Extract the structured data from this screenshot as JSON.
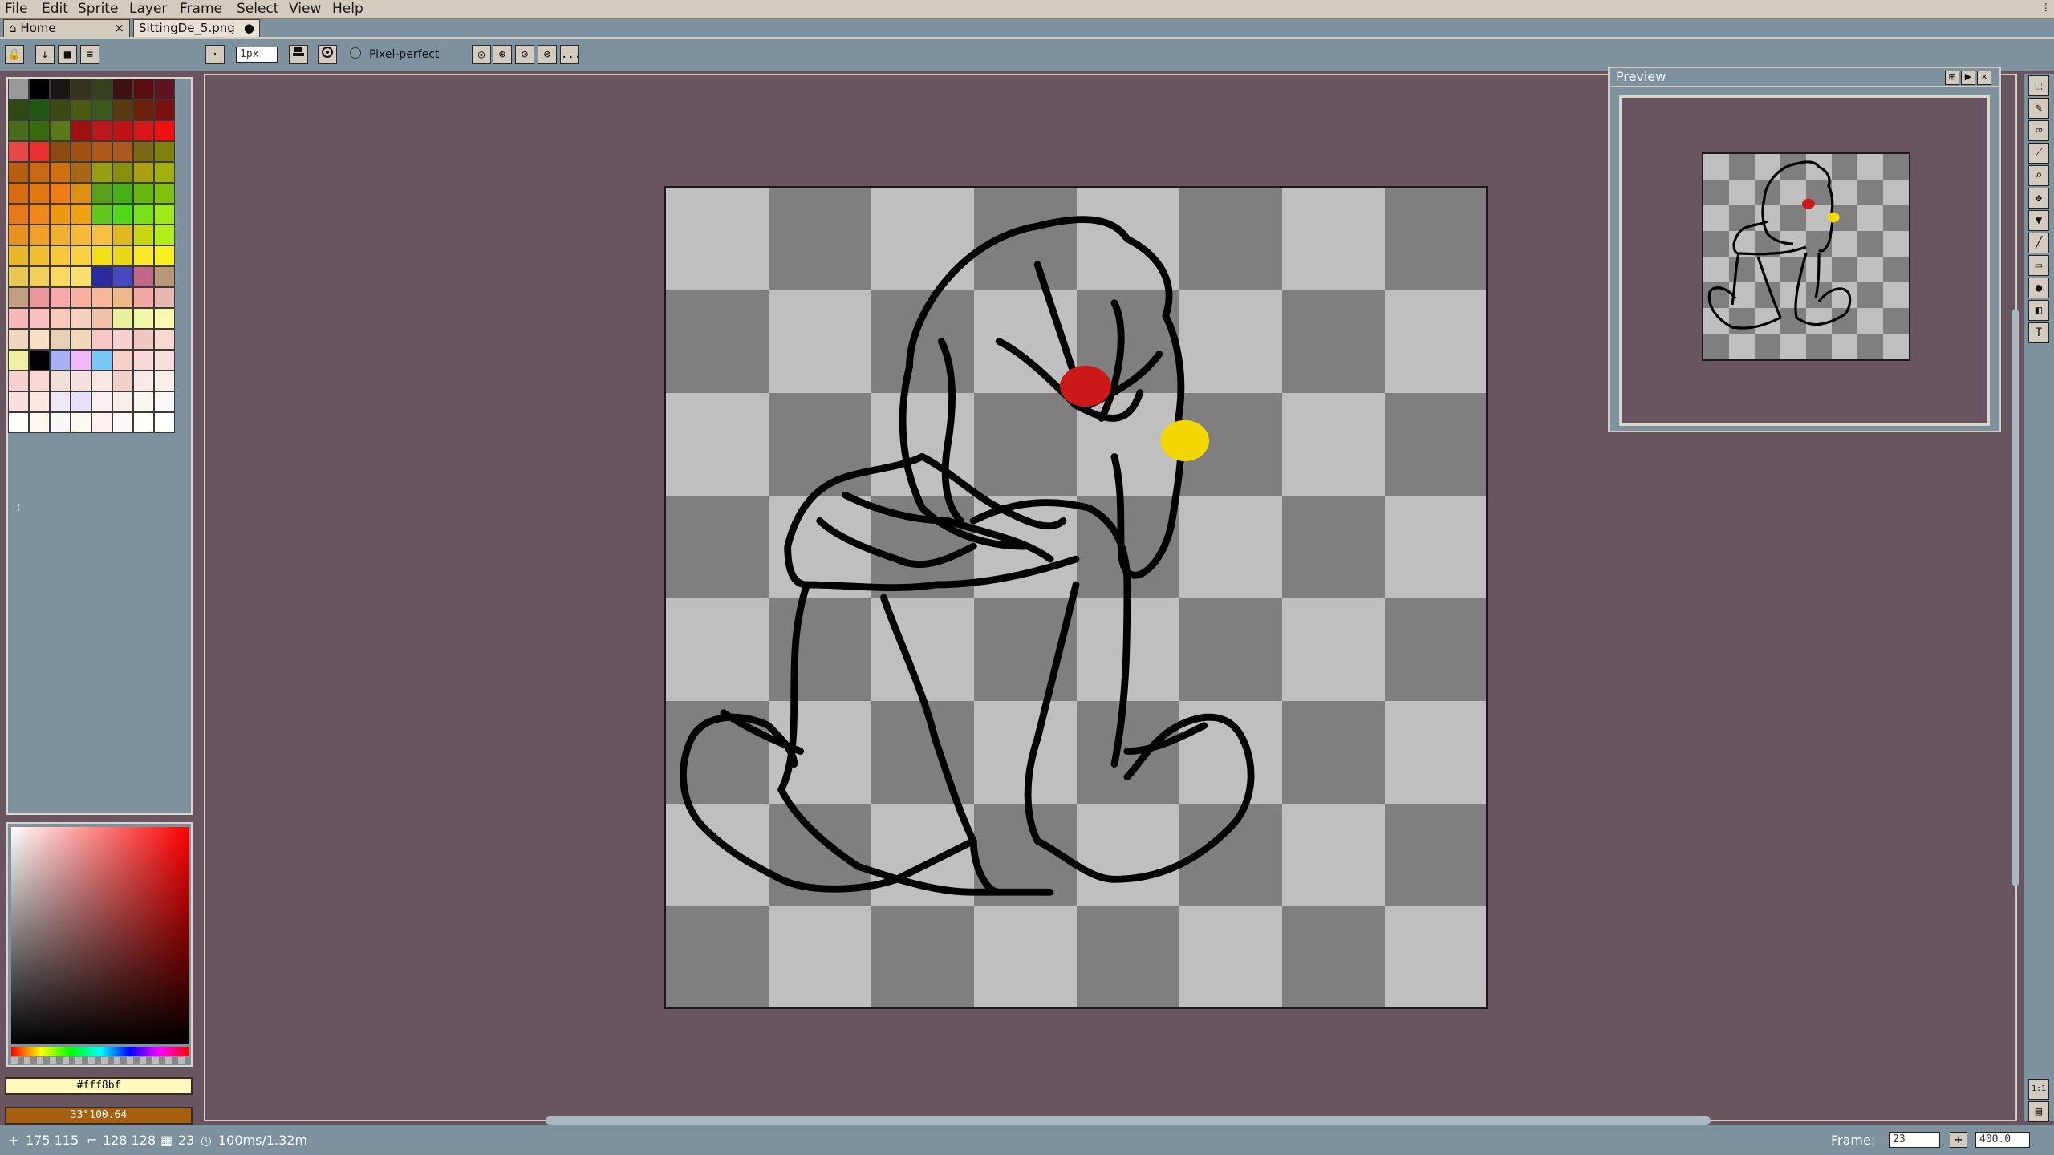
{
  "menu": [
    "File",
    "Edit",
    "Sprite",
    "Layer",
    "Frame",
    "Select",
    "View",
    "Help"
  ],
  "tabs": [
    {
      "label": "Home",
      "close": "×"
    },
    {
      "label": "SittingDe_5.png",
      "close": "●"
    }
  ],
  "toolbar": {
    "brush_size": "1px",
    "pixel_perfect_label": "Pixel-perfect",
    "more_label": "..."
  },
  "palette_colors": [
    "#9a9a9a",
    "#000000",
    "#1a1612",
    "#35331d",
    "#33421e",
    "#3c1212",
    "#5c0c0c",
    "#5e1322",
    "#2e4a12",
    "#235816",
    "#3b4a14",
    "#4b5a10",
    "#3a5a1c",
    "#5a3a10",
    "#6a2008",
    "#7a1010",
    "#4a6a1c",
    "#3a6a10",
    "#5a7a18",
    "#a01010",
    "#b81818",
    "#c01414",
    "#d81818",
    "#f01010",
    "#e84848",
    "#e83030",
    "#8a4a10",
    "#a05010",
    "#b05818",
    "#a85a20",
    "#7a6a18",
    "#808010",
    "#b85c10",
    "#c86810",
    "#d07010",
    "#a86818",
    "#98a010",
    "#889010",
    "#a8a010",
    "#a0b010",
    "#d86c10",
    "#e07a10",
    "#f07c14",
    "#e09010",
    "#58a018",
    "#48b018",
    "#68b810",
    "#80c010",
    "#e87818",
    "#f08818",
    "#ec9810",
    "#f0a010",
    "#60c818",
    "#50d818",
    "#78e018",
    "#a0e818",
    "#e89020",
    "#f0a028",
    "#f0b030",
    "#f8b838",
    "#f8c040",
    "#e0b820",
    "#c8d810",
    "#b0f018",
    "#e8b828",
    "#f0c030",
    "#f8c838",
    "#f8d040",
    "#f0e018",
    "#e8d818",
    "#f8e828",
    "#f8f020",
    "#e8c850",
    "#f0d058",
    "#f8d860",
    "#f8e070",
    "#2a2aa0",
    "#4848c0",
    "#c06888",
    "#b89878",
    "#c0a080",
    "#e89898",
    "#f8a8a8",
    "#f8b0a0",
    "#f8b898",
    "#f0b888",
    "#f0a8a0",
    "#e8b8b0",
    "#f8b8b8",
    "#f8c0c0",
    "#f8c8b8",
    "#f8d0c0",
    "#f0c0a8",
    "#e8f0a0",
    "#f0f8a8",
    "#f8f8b0",
    "#f0d8c0",
    "#f8e0c8",
    "#e8d0b8",
    "#f0d8b8",
    "#f8c8c8",
    "#f8d0d0",
    "#f0c8c0",
    "#f8d8d0",
    "#f0f0a0",
    "#000000",
    "#a8b0f8",
    "#f0b8f8",
    "#78c8f8",
    "#f8d0c8",
    "#f8d8d8",
    "#f8e0d8",
    "#f8d0d0",
    "#f8d8d0",
    "#f0e0d8",
    "#f8e0e0",
    "#f8e8e0",
    "#f0d0c8",
    "#f8e8e8",
    "#f8f0e8",
    "#f8e0e0",
    "#f8e8e0",
    "#f0e8f8",
    "#e8e0f8",
    "#f8f0f0",
    "#f8f0e8",
    "#f8f8f0",
    "#fff8f8",
    "#ffffff",
    "#fff8f0",
    "#f8f8f8",
    "#fffaf0",
    "#fff0f0",
    "#fff8f8",
    "#fffff8",
    "#ffffff"
  ],
  "fg_color": {
    "hex": "#fff8bf",
    "label": "#fff8bf"
  },
  "bg_color": {
    "hex": "#a65f0f",
    "label": "33°100.64"
  },
  "preview": {
    "title": "Preview"
  },
  "status": {
    "cursor": "175 115",
    "size": "128 128",
    "frame_no": "23",
    "duration": "100ms/1.32m",
    "frame_label": "Frame:",
    "frame_value": "23",
    "zoom": "400.0"
  },
  "icons": {
    "lock": "🔒",
    "down": "↓",
    "square": "■",
    "menu": "≡",
    "dot": "·",
    "stamp": "⌂",
    "settings": "⚙",
    "home": "⌂",
    "plus": "+",
    "grid1": "1:1",
    "grid2": "▤",
    "text": "T"
  }
}
